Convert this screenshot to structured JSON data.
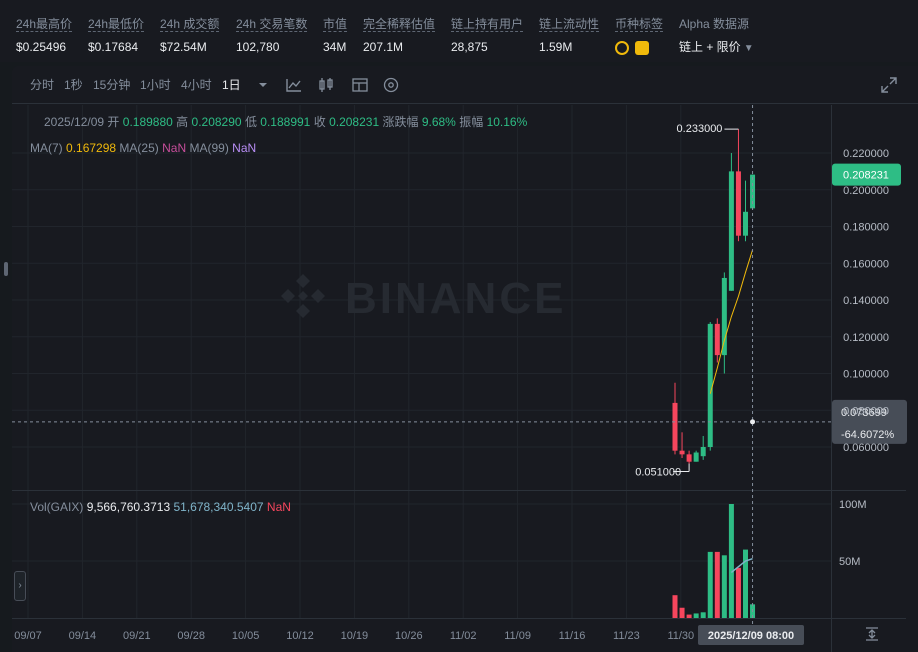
{
  "stats": [
    {
      "label": "24h最高价",
      "value": "$0.25496"
    },
    {
      "label": "24h最低价",
      "value": "$0.17684"
    },
    {
      "label": "24h 成交额",
      "value": "$72.54M"
    },
    {
      "label": "24h 交易笔数",
      "value": "102,780"
    },
    {
      "label": "市值",
      "value": "34M"
    },
    {
      "label": "完全稀释估值",
      "value": "207.1M"
    },
    {
      "label": "链上持有用户",
      "value": "28,875"
    },
    {
      "label": "链上流动性",
      "value": "1.59M"
    },
    {
      "label": "币种标签",
      "value": ""
    },
    {
      "label": "Alpha 数据源",
      "value": "链上 + 限价"
    }
  ],
  "toolbar": {
    "intervals": [
      "分时",
      "1秒",
      "15分钟",
      "1小时",
      "4小时",
      "1日"
    ],
    "active_interval": "1日",
    "icons": [
      "dropdown-caret-icon",
      "indicator-icon",
      "candle-type-icon",
      "layout-icon",
      "settings-icon",
      "fullscreen-icon"
    ]
  },
  "ohlc": {
    "date": "2025/12/09",
    "open_label": "开",
    "open": "0.189880",
    "high_label": "高",
    "high": "0.208290",
    "low_label": "低",
    "low": "0.188991",
    "close_label": "收",
    "close": "0.208231",
    "change_label": "涨跌幅",
    "change": "9.68%",
    "amp_label": "振幅",
    "amp": "10.16%"
  },
  "ma": {
    "ma7_label": "MA(7)",
    "ma7": "0.167298",
    "ma25_label": "MA(25)",
    "ma25": "NaN",
    "ma99_label": "MA(99)",
    "ma99": "NaN"
  },
  "vol": {
    "label": "Vol(GAIX)",
    "v1": "9,566,760.3713",
    "v2": "51,678,340.5407",
    "v3": "NaN"
  },
  "watermark": "BINANCE",
  "colors": {
    "up": "#2ebd85",
    "down": "#f6465d",
    "ma7": "#f0b90b",
    "vol_ma": "#7fb4c9"
  },
  "chart_data": {
    "type": "candlestick",
    "price_axis_labels": [
      "0.220000",
      "0.200000",
      "0.180000",
      "0.160000",
      "0.140000",
      "0.120000",
      "0.100000",
      "0.080000",
      "0.060000"
    ],
    "price_ticks": [
      0.22,
      0.2,
      0.18,
      0.16,
      0.14,
      0.12,
      0.1,
      0.08,
      0.06
    ],
    "volume_axis_labels": [
      "100M",
      "50M"
    ],
    "volume_ticks": [
      100,
      50
    ],
    "x_axis_labels": [
      "09/07",
      "09/14",
      "09/21",
      "09/28",
      "10/05",
      "10/12",
      "10/19",
      "10/26",
      "11/02",
      "11/09",
      "11/16",
      "11/23",
      "11/30"
    ],
    "crosshair_date": "2025/12/09 08:00",
    "current_price_label": "0.208231",
    "current_price": 0.208231,
    "crosshair_price": "0.073699",
    "crosshair_change": "-64.6072%",
    "crosshair_value": 0.073699,
    "high_annotation": "0.233000",
    "high_value": 0.233,
    "low_annotation": "0.051000",
    "low_value": 0.051,
    "candles": [
      {
        "o": 0.084,
        "h": 0.095,
        "l": 0.056,
        "c": 0.058
      },
      {
        "o": 0.058,
        "h": 0.068,
        "l": 0.054,
        "c": 0.056
      },
      {
        "o": 0.056,
        "h": 0.058,
        "l": 0.051,
        "c": 0.052
      },
      {
        "o": 0.052,
        "h": 0.058,
        "l": 0.052,
        "c": 0.057
      },
      {
        "o": 0.055,
        "h": 0.066,
        "l": 0.053,
        "c": 0.06
      },
      {
        "o": 0.06,
        "h": 0.128,
        "l": 0.058,
        "c": 0.127
      },
      {
        "o": 0.127,
        "h": 0.13,
        "l": 0.106,
        "c": 0.11
      },
      {
        "o": 0.11,
        "h": 0.155,
        "l": 0.1,
        "c": 0.152
      },
      {
        "o": 0.145,
        "h": 0.22,
        "l": 0.145,
        "c": 0.21
      },
      {
        "o": 0.21,
        "h": 0.233,
        "l": 0.172,
        "c": 0.175
      },
      {
        "o": 0.175,
        "h": 0.205,
        "l": 0.172,
        "c": 0.188
      },
      {
        "o": 0.18988,
        "h": 0.20829,
        "l": 0.188991,
        "c": 0.208231
      }
    ],
    "volumes": [
      20,
      9,
      3,
      4,
      5,
      58,
      58,
      55,
      100,
      44,
      60,
      12
    ],
    "ma7": [
      0.089,
      0.103,
      0.118,
      0.131,
      0.142,
      0.155,
      0.167298
    ],
    "vol_ma": [
      40,
      45,
      50,
      52
    ]
  }
}
